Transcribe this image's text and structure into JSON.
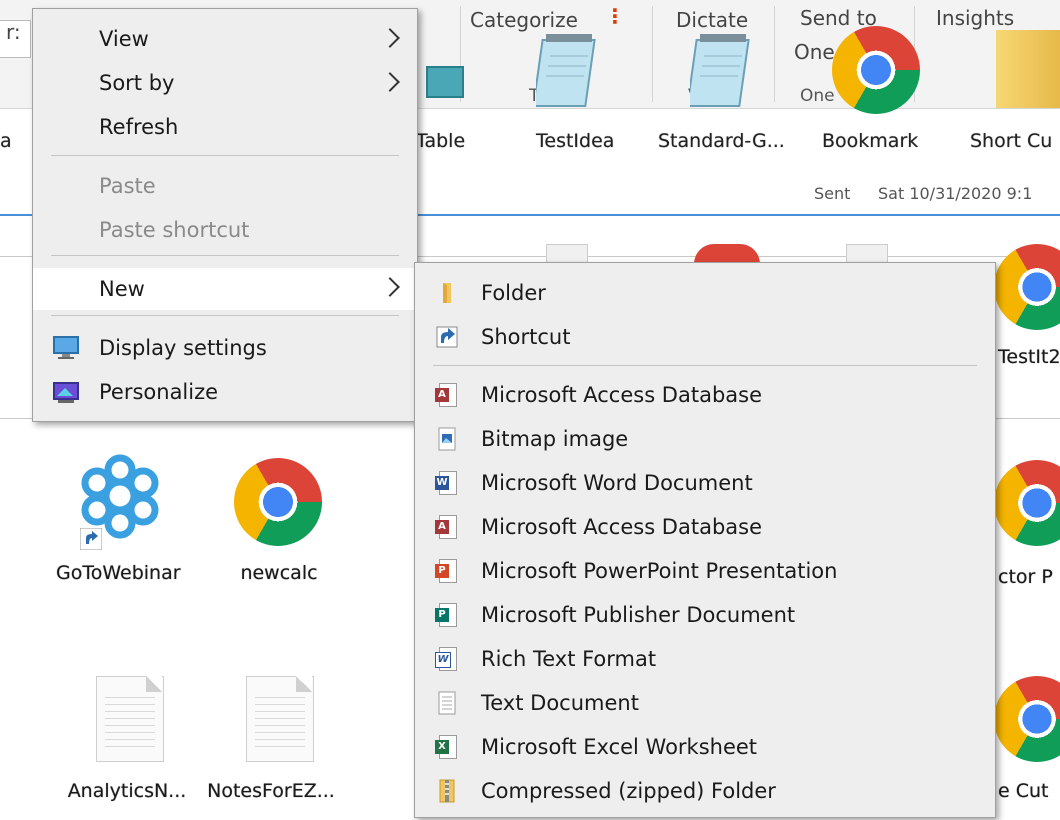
{
  "ribbon": {
    "left_fragment": "r:",
    "categorize": "Categorize",
    "categorize_tag": "Tag",
    "dictate": "Dictate",
    "dictate_sub": "Vo",
    "send_to": "Send to",
    "send_to_sub": "One",
    "send_to_sub2": "One",
    "insights": "Insights"
  },
  "shortcut_row": {
    "left_fragment": "a",
    "table": "Table",
    "testidea": "TestIdea",
    "standard": "Standard-G...",
    "bookmark": "Bookmark",
    "short_cut": "Short Cu"
  },
  "email_meta": {
    "status": "Sent",
    "date": "Sat 10/31/2020 9:1"
  },
  "desktop": {
    "icons": [
      {
        "label": "GoToWebinar",
        "icon": "gotowebinar-icon"
      },
      {
        "label": "newcalc",
        "icon": "chrome-icon"
      },
      {
        "label": "AnalyticsN...",
        "icon": "text-document-icon"
      },
      {
        "label": "NotesForEZ...",
        "icon": "text-document-icon"
      }
    ],
    "right_labels": [
      "TestIt2",
      "ctor P",
      "e Cut"
    ]
  },
  "context_menu": {
    "items": [
      {
        "label": "View",
        "submenu": true
      },
      {
        "label": "Sort by",
        "submenu": true
      },
      {
        "label": "Refresh"
      },
      {
        "label": "Paste",
        "disabled": true
      },
      {
        "label": "Paste shortcut",
        "disabled": true
      },
      {
        "label": "New",
        "submenu": true
      },
      {
        "label": "Display settings",
        "icon": "display-icon"
      },
      {
        "label": "Personalize",
        "icon": "personalize-icon"
      }
    ]
  },
  "new_submenu": {
    "items": [
      {
        "label": "Folder",
        "icon": "folder-icon"
      },
      {
        "label": "Shortcut",
        "icon": "shortcut-icon"
      },
      {
        "label": "Microsoft Access Database",
        "icon": "access-icon"
      },
      {
        "label": "Bitmap image",
        "icon": "bitmap-icon"
      },
      {
        "label": "Microsoft Word Document",
        "icon": "word-icon"
      },
      {
        "label": "Microsoft Access Database",
        "icon": "access-icon"
      },
      {
        "label": "Microsoft PowerPoint Presentation",
        "icon": "powerpoint-icon"
      },
      {
        "label": "Microsoft Publisher Document",
        "icon": "publisher-icon"
      },
      {
        "label": "Rich Text Format",
        "icon": "wordpad-icon"
      },
      {
        "label": "Text Document",
        "icon": "text-icon"
      },
      {
        "label": "Microsoft Excel Worksheet",
        "icon": "excel-icon"
      },
      {
        "label": "Compressed (zipped) Folder",
        "icon": "zip-folder-icon"
      }
    ]
  },
  "colors": {
    "menu_bg": "#eeeeee",
    "hover_bg": "#ffffff",
    "disabled_text": "#8a8a8a",
    "accent_blue": "#4a90d9",
    "access_red": "#a4373a",
    "word_blue": "#2b579a",
    "powerpoint_orange": "#d24726",
    "publisher_teal": "#077568",
    "excel_green": "#217346"
  }
}
